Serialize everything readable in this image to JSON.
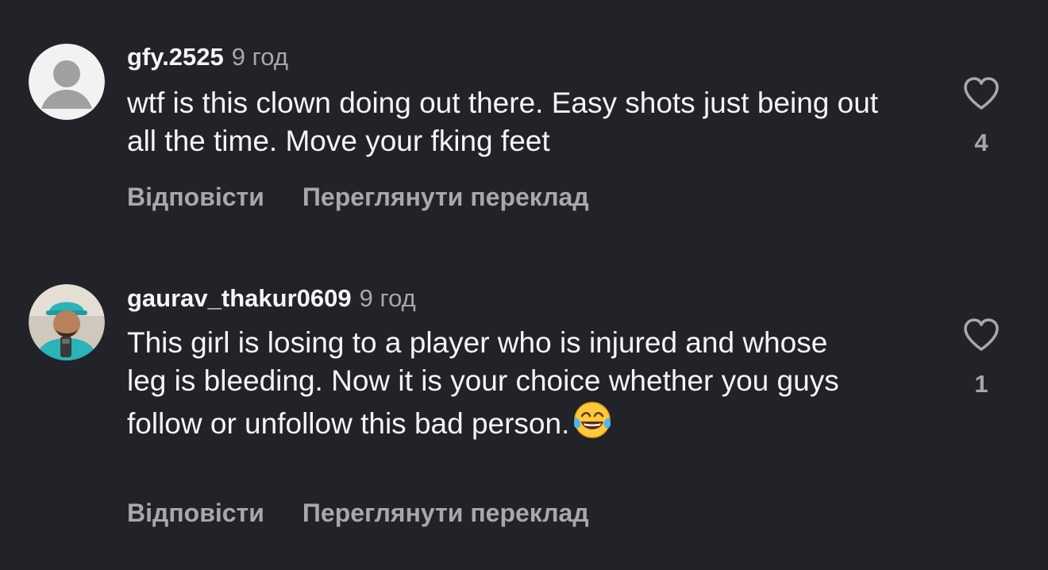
{
  "comments": [
    {
      "username": "gfy.2525",
      "time": "9 год",
      "text": "wtf is this clown doing out there. Easy shots just being out all the time. Move your fking feet",
      "emoji": "",
      "reply_label": "Відповісти",
      "translate_label": "Переглянути переклад",
      "likes": "4",
      "avatar_icon": "default-avatar-icon"
    },
    {
      "username": "gaurav_thakur0609",
      "time": "9 год",
      "text": "This girl is losing to a player who is injured and whose leg is bleeding. Now it is your choice whether you guys follow or unfollow this bad person.",
      "emoji": "face-with-tears-of-joy",
      "reply_label": "Відповісти",
      "translate_label": "Переглянути переклад",
      "likes": "1",
      "avatar_icon": "user-photo"
    }
  ],
  "colors": {
    "background": "#212328",
    "primary_text": "#f5f5f5",
    "secondary_text": "#a8a8a8"
  }
}
